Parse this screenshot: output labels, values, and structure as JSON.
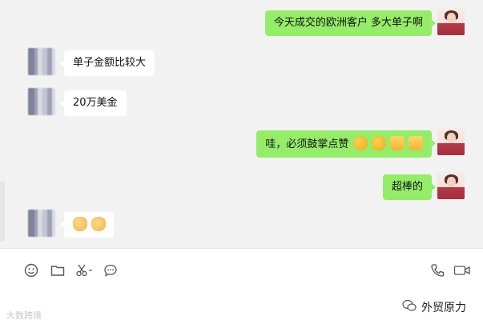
{
  "messages": [
    {
      "side": "out",
      "text": "今天成交的欧洲客户   多大单子啊"
    },
    {
      "side": "in",
      "text": "单子金额比较大"
    },
    {
      "side": "in",
      "text": "20万美金"
    },
    {
      "side": "out",
      "text": "哇，必须鼓掌点赞",
      "emojis": [
        "clap",
        "clap",
        "thumbs-up",
        "thumbs-up"
      ]
    },
    {
      "side": "out",
      "text": "超棒的"
    },
    {
      "side": "in",
      "text": "",
      "emojis": [
        "victory",
        "victory"
      ]
    }
  ],
  "toolbar": {
    "left_tools": [
      "emoji-icon",
      "folder-icon",
      "scissors-icon",
      "chat-bubble-icon"
    ],
    "right_tools": [
      "phone-icon",
      "video-camera-icon"
    ]
  },
  "watermarks": {
    "left": "大数跨境",
    "right": "外贸原力"
  },
  "colors": {
    "chat_bg": "#f2f2f2",
    "outgoing_bubble": "#95ec69",
    "incoming_bubble": "#ffffff",
    "toolbar_bg": "#ffffff"
  }
}
